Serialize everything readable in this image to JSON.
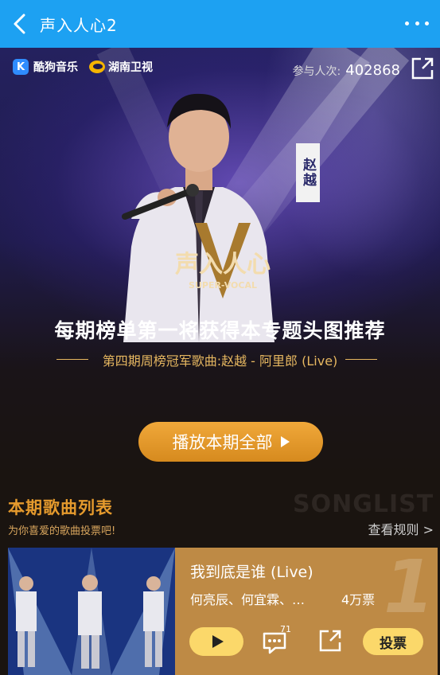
{
  "topbar": {
    "title": "声入人心2"
  },
  "hero": {
    "logo_kugou_mark": "K",
    "logo_kugou": "酷狗音乐",
    "logo_hunan": "湖南卫视",
    "participants_label": "参与人次:",
    "participants_count": "402868",
    "singer_name": "赵越",
    "show_logo_cn": "声入人心",
    "show_logo_en": "SUPER-VOCAL",
    "headline": "每期榜单第一将获得本专题头图推荐",
    "subline": "第四期周榜冠军歌曲:赵越 - 阿里郎 (Live)",
    "play_all_label": "播放本期全部"
  },
  "section": {
    "title": "本期歌曲列表",
    "subtitle": "为你喜爱的歌曲投票吧!",
    "watermark": "SONGLIST",
    "rules_link": "查看规则 >"
  },
  "songs": [
    {
      "rank": "1",
      "title": "我到底是谁 (Live)",
      "artists": "何亮辰、何宜霖、…",
      "votes": "4万票",
      "comment_count": "71",
      "vote_label": "投票"
    }
  ],
  "colors": {
    "topbar": "#1da1f2",
    "accent_orange": "#e59a2d",
    "gold": "#e6b760",
    "card": "#be8a45",
    "button_yellow": "#fbd86a"
  },
  "icons": [
    "back-icon",
    "more-icon",
    "share-icon",
    "play-icon",
    "comment-icon",
    "vote-icon"
  ]
}
